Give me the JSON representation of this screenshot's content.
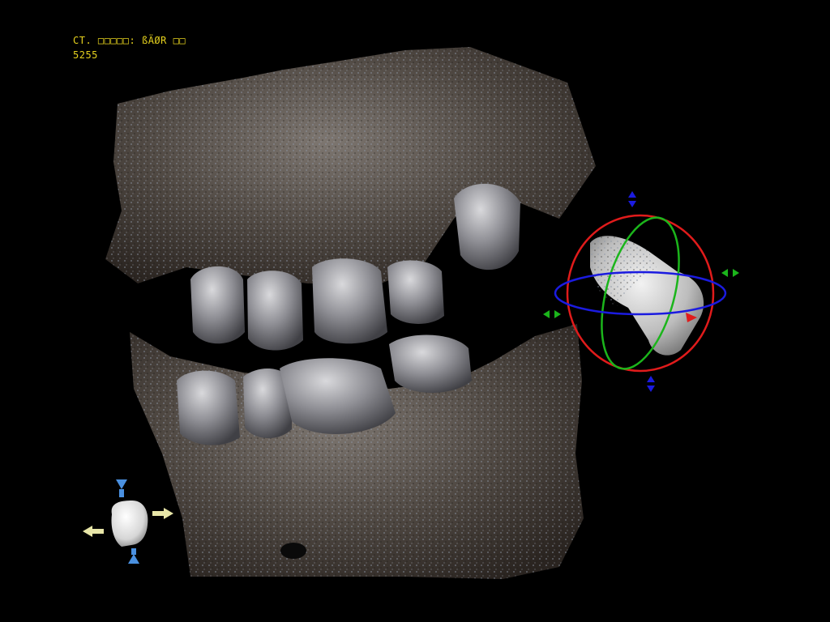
{
  "overlay": {
    "scan_label": "CT. □□□□□: ßÄØR □□",
    "scan_id": "5255"
  },
  "colors": {
    "background": "#000000",
    "overlay_text": "#e6d21e",
    "rotate_ring_x": "#e01b1b",
    "rotate_ring_y": "#1bb51b",
    "rotate_ring_z": "#1b1be0",
    "orientation_arrow_vertical": "#4a90e0",
    "orientation_arrow_horizontal": "#e8e6a8"
  },
  "icons": {
    "manipulator": "rotation-gizmo-icon",
    "orientation": "head-orientation-icon"
  }
}
